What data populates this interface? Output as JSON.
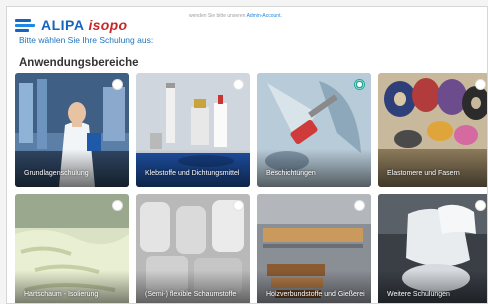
{
  "header": {
    "logo_primary": "ALIPA",
    "logo_secondary": "isopo",
    "note_text": "wenden Sie bitte unseren",
    "note_link": "Admin-Account."
  },
  "intro_text": "Bitte wählen Sie Ihre Schulung aus:",
  "section_title": "Anwendungsbereiche",
  "tiles": [
    {
      "label": "Grundlagenschulung",
      "selected": false
    },
    {
      "label": "Klebstoffe und Dichtungsmittel",
      "selected": false
    },
    {
      "label": "Beschichtungen",
      "selected": true
    },
    {
      "label": "Elastomere und Fasern",
      "selected": false
    },
    {
      "label": "Hartschaum - Isolierung",
      "selected": false
    },
    {
      "label": "(Semi-) flexible Schaumstoffe",
      "selected": false
    },
    {
      "label": "Holzverbundstoffe und Gießerei",
      "selected": false
    },
    {
      "label": "Weitere Schulungen",
      "selected": false
    }
  ],
  "colors": {
    "accent": "#26a69a",
    "link": "#1e73be"
  }
}
